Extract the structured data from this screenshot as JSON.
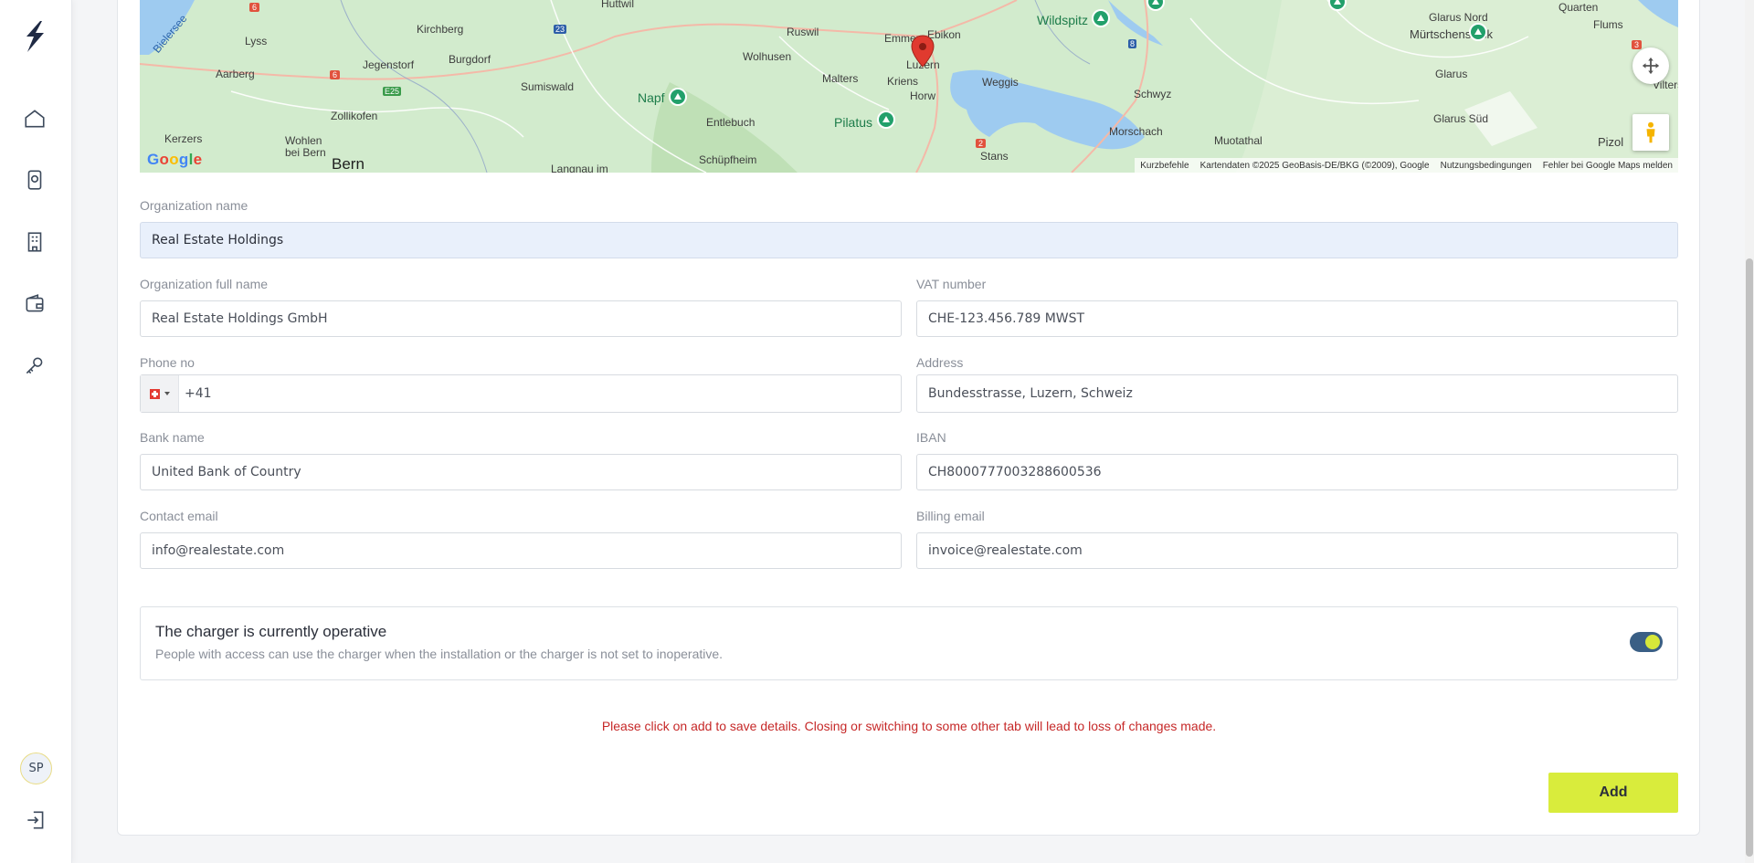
{
  "colors": {
    "accent": "#d9ec3c",
    "toggle_track": "#3a5f85",
    "warning": "#c62828",
    "highlight_field": "#e9f0fb"
  },
  "sidebar": {
    "logo": "bolt-logo",
    "items": [
      {
        "name": "home-icon"
      },
      {
        "name": "charger-icon"
      },
      {
        "name": "building-icon"
      },
      {
        "name": "wallet-icon"
      },
      {
        "name": "key-icon"
      }
    ],
    "avatar": "SP",
    "logout": "logout-icon"
  },
  "map": {
    "labels": {
      "huttwil": "Huttwil",
      "kirchberg": "Kirchberg",
      "lyss": "Lyss",
      "bielersee": "Bielersee",
      "jegenstorf": "Jegenstorf",
      "burgdorf": "Burgdorf",
      "aarberg": "Aarberg",
      "sumiswald": "Sumiswald",
      "wolhusen": "Wolhusen",
      "ruswil": "Ruswil",
      "malters": "Malters",
      "emmen": "Emmen",
      "ebikon": "Ebikon",
      "kriens": "Kriens",
      "luzern": "Luzern",
      "horw": "Horw",
      "weggis": "Weggis",
      "zollikofen": "Zollikofen",
      "kerzers": "Kerzers",
      "wohlen": "Wohlen\nbei Bern",
      "bern": "Bern",
      "langnau": "Langnau im",
      "napf": "Napf",
      "entlebuch": "Entlebuch",
      "schupfheim": "Schüpfheim",
      "pilatus": "Pilatus",
      "stans": "Stans",
      "wildspitz": "Wildspitz",
      "schwyz": "Schwyz",
      "morschach": "Morschach",
      "muotathal": "Muotathal",
      "glarus_nord": "Glarus Nord",
      "murtschenstock": "Mürtschenstock",
      "glarus": "Glarus",
      "glarus_sud": "Glarus Süd",
      "quarten": "Quarten",
      "flums": "Flums",
      "vilters": "Vilters",
      "pizol": "Pizol",
      "road_6a": "6",
      "road_6b": "6",
      "road_23": "23",
      "road_e25": "E25",
      "road_2": "2",
      "road_8": "8",
      "road_3": "3"
    },
    "google": "Google",
    "footer": {
      "shortcuts": "Kurzbefehle",
      "data": "Kartendaten ©2025 GeoBasis-DE/BKG (©2009), Google",
      "terms": "Nutzungsbedingungen",
      "report": "Fehler bei Google Maps melden"
    }
  },
  "form": {
    "org_name": {
      "label": "Organization name",
      "value": "Real Estate Holdings"
    },
    "org_full_name": {
      "label": "Organization full name",
      "value": "Real Estate Holdings GmbH"
    },
    "vat": {
      "label": "VAT number",
      "value": "CHE-123.456.789 MWST"
    },
    "phone": {
      "label": "Phone no",
      "value": "+41",
      "country": "CH"
    },
    "address": {
      "label": "Address",
      "value": "Bundesstrasse, Luzern, Schweiz"
    },
    "bank": {
      "label": "Bank name",
      "value": "United Bank of Country"
    },
    "iban": {
      "label": "IBAN",
      "value": "CH8000777003288600536"
    },
    "contact_email": {
      "label": "Contact email",
      "value": "info@realestate.com"
    },
    "billing_email": {
      "label": "Billing email",
      "value": "invoice@realestate.com"
    }
  },
  "operative": {
    "title": "The charger is currently operative",
    "description": "People with access can use the charger when the installation or the charger is not set to inoperative.",
    "enabled": true
  },
  "warning": "Please click on add to save details. Closing or switching to some other tab will lead to loss of changes made.",
  "add_button": "Add"
}
